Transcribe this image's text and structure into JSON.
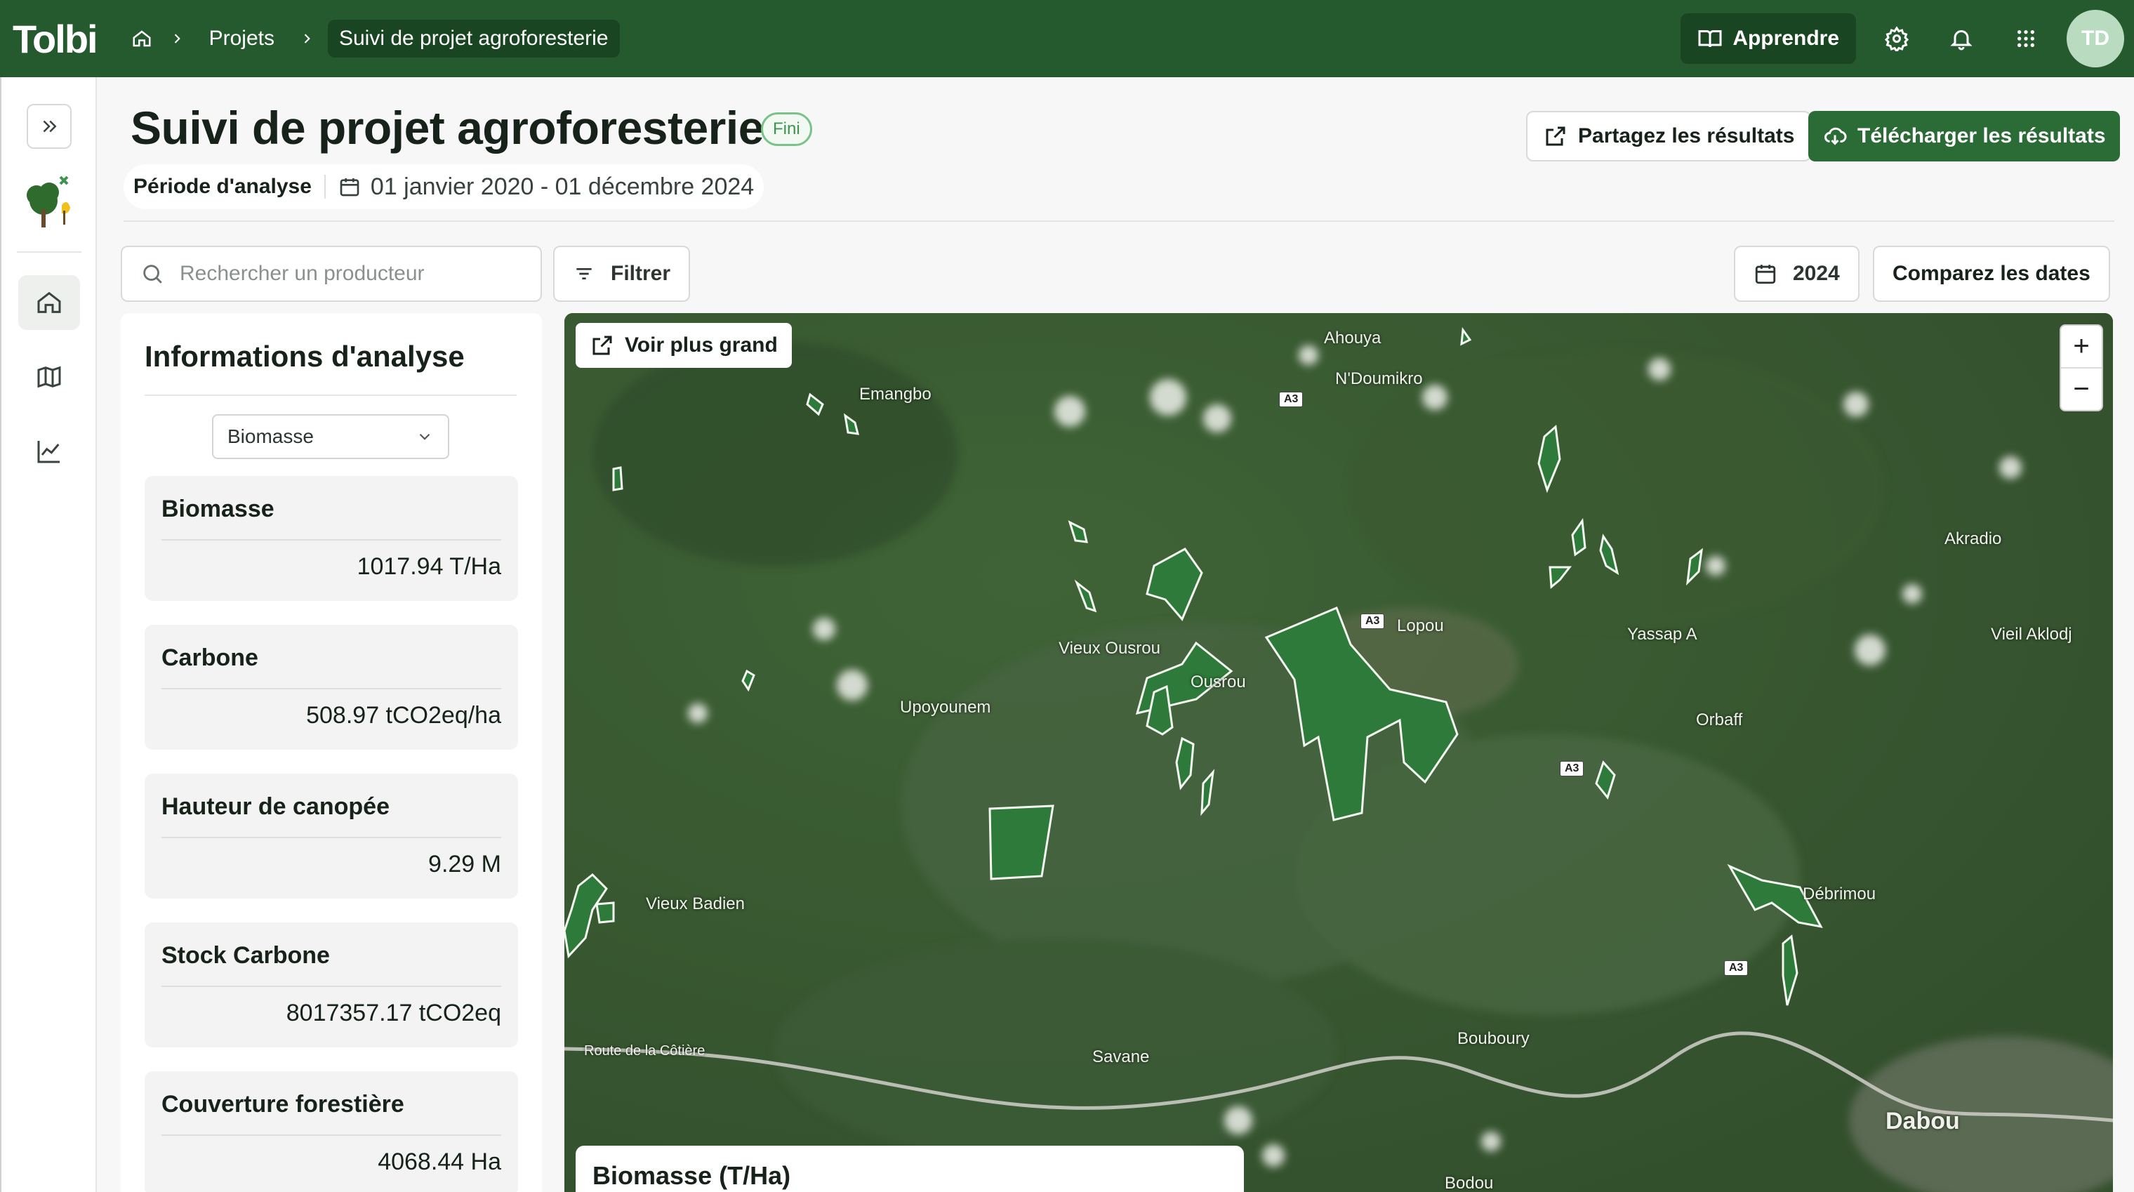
{
  "app": {
    "logo": "Tolbi"
  },
  "breadcrumbs": {
    "projects": "Projets",
    "current": "Suivi de projet agroforesterie"
  },
  "topbar": {
    "learn_label": "Apprendre",
    "avatar_initials": "TD"
  },
  "header": {
    "title": "Suivi de projet agroforesterie",
    "status_badge": "Fini",
    "period_label": "Période d'analyse",
    "period_value": "01 janvier 2020 - 01 décembre 2024",
    "share_label": "Partagez les résultats",
    "download_label": "Télécharger les résultats"
  },
  "toolbar": {
    "search_placeholder": "Rechercher un producteur",
    "filter_label": "Filtrer",
    "year": "2024",
    "compare_label": "Comparez les dates"
  },
  "panel": {
    "title": "Informations d'analyse",
    "selected_layer": "Biomasse",
    "metrics": [
      {
        "name": "Biomasse",
        "value": "1017.94 T/Ha"
      },
      {
        "name": "Carbone",
        "value": "508.97 tCO2eq/ha"
      },
      {
        "name": "Hauteur de canopée",
        "value": "9.29 M"
      },
      {
        "name": "Stock Carbone",
        "value": "8017357.17 tCO2eq"
      },
      {
        "name": "Couverture forestière",
        "value": "4068.44 Ha"
      }
    ]
  },
  "map": {
    "expand_label": "Voir plus grand",
    "legend_title": "Biomasse (T/Ha)",
    "places": {
      "ahouya": "Ahouya",
      "ndoumikro": "N'Doumikro",
      "emangbo": "Emangbo",
      "lopou": "Lopou",
      "vieux_ousrou": "Vieux Ousrou",
      "ousrou": "Ousrou",
      "upoyounem": "Upoyounem",
      "akradio": "Akradio",
      "yassap": "Yassap A",
      "vieil_aklodj": "Vieil Aklodj",
      "orbaff": "Orbaff",
      "vieux_badien": "Vieux Badien",
      "debrimou": "Débrimou",
      "route_cotiere": "Route de la Côtière",
      "savane": "Savane",
      "bouboury": "Bouboury",
      "dabou": "Dabou",
      "bodou": "Bodou"
    },
    "road_tag": "A3"
  },
  "colors": {
    "brand": "#255a2e",
    "accent": "#2b6b36",
    "badge": "#7bc28a"
  }
}
